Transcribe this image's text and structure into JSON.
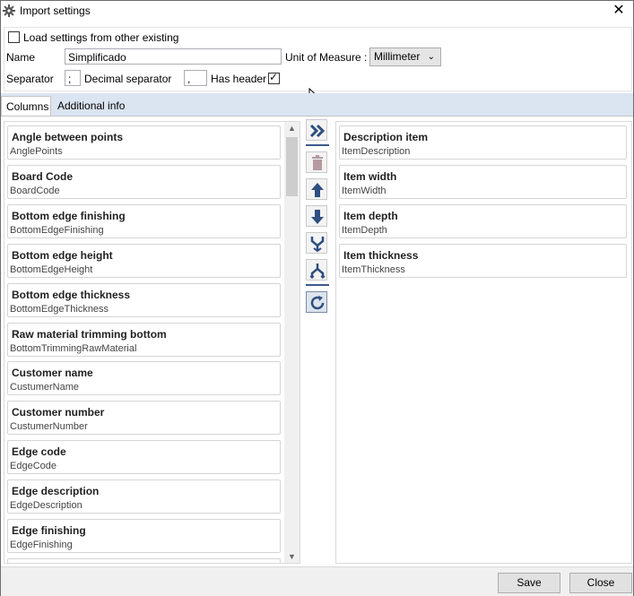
{
  "window": {
    "title": "Import settings",
    "close_glyph": "✕",
    "icon": "gear-icon"
  },
  "settings": {
    "load_label": "Load settings from other existing",
    "load_checked": false,
    "name_label": "Name",
    "name_value": "Simplificado",
    "unit_label": "Unit of Measure :",
    "unit_value": "Millimeter",
    "separator_label": "Separator",
    "separator_value": ";",
    "decimal_label": "Decimal separator",
    "decimal_value": ",",
    "header_label": "Has header",
    "header_checked": true
  },
  "tabs": [
    {
      "label": "Columns",
      "active": true
    },
    {
      "label": "Additional info",
      "active": false
    }
  ],
  "available_columns": [
    {
      "title": "Angle between points",
      "key": "AnglePoints"
    },
    {
      "title": "Board Code",
      "key": "BoardCode"
    },
    {
      "title": "Bottom edge finishing",
      "key": "BottomEdgeFinishing"
    },
    {
      "title": "Bottom edge height",
      "key": "BottomEdgeHeight"
    },
    {
      "title": "Bottom edge thickness",
      "key": "BottomEdgeThickness"
    },
    {
      "title": "Raw material trimming bottom",
      "key": "BottomTrimmingRawMaterial"
    },
    {
      "title": "Customer name",
      "key": "CustumerName"
    },
    {
      "title": "Customer number",
      "key": "CustumerNumber"
    },
    {
      "title": "Edge code",
      "key": "EdgeCode"
    },
    {
      "title": "Edge description",
      "key": "EdgeDescription"
    },
    {
      "title": "Edge finishing",
      "key": "EdgeFinishing"
    }
  ],
  "selected_columns": [
    {
      "title": "Description item",
      "key": "ItemDescription"
    },
    {
      "title": "Item width",
      "key": "ItemWidth"
    },
    {
      "title": "Item depth",
      "key": "ItemDepth"
    },
    {
      "title": "Item thickness",
      "key": "ItemThickness"
    }
  ],
  "tools": [
    "move-all-right-icon",
    "delete-icon",
    "move-up-icon",
    "move-down-icon",
    "merge-icon",
    "split-icon",
    "refresh-icon"
  ],
  "buttons": {
    "save": "Save",
    "close": "Close"
  },
  "colors": {
    "accent": "#3c5a8a",
    "tabstrip": "#dbe5f1"
  }
}
